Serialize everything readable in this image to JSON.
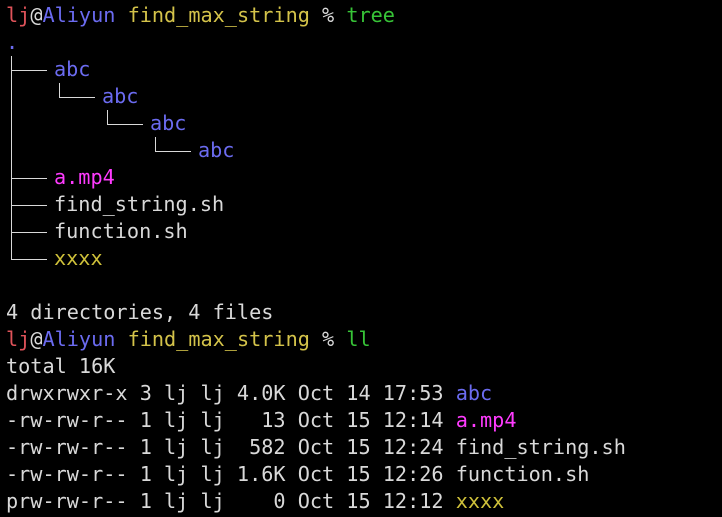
{
  "prompt": {
    "user": "lj",
    "at": "@",
    "host": "Aliyun",
    "cwd": "find_max_string",
    "symbol": "%"
  },
  "colors": {
    "background": "#000000",
    "user": "#e0535a",
    "host": "#6b6bf0",
    "cwd": "#d4c34a",
    "command": "#37c437",
    "directory": "#6b6bf0",
    "media": "#ff3bff",
    "fifo": "#cfc13a",
    "text": "#d9d9d9"
  },
  "commands": {
    "first": "tree",
    "second": "ll"
  },
  "tree": {
    "root": ".",
    "entries": [
      {
        "name": "abc",
        "kind": "dir"
      },
      {
        "name": "abc",
        "kind": "dir"
      },
      {
        "name": "abc",
        "kind": "dir"
      },
      {
        "name": "abc",
        "kind": "dir"
      },
      {
        "name": "a.mp4",
        "kind": "media"
      },
      {
        "name": "find_string.sh",
        "kind": "file"
      },
      {
        "name": "function.sh",
        "kind": "file"
      },
      {
        "name": "xxxx",
        "kind": "fifo"
      }
    ],
    "summary": "4 directories, 4 files"
  },
  "listing": {
    "total": "total 16K",
    "rows": [
      {
        "meta": "drwxrwxr-x 3 lj lj 4.0K Oct 14 17:53 ",
        "name": "abc",
        "kind": "dir"
      },
      {
        "meta": "-rw-rw-r-- 1 lj lj   13 Oct 15 12:14 ",
        "name": "a.mp4",
        "kind": "media"
      },
      {
        "meta": "-rw-rw-r-- 1 lj lj  582 Oct 15 12:24 ",
        "name": "find_string.sh",
        "kind": "file"
      },
      {
        "meta": "-rw-rw-r-- 1 lj lj 1.6K Oct 15 12:26 ",
        "name": "function.sh",
        "kind": "file"
      },
      {
        "meta": "prw-rw-r-- 1 lj lj    0 Oct 15 12:12 ",
        "name": "xxxx",
        "kind": "fifo"
      }
    ]
  }
}
